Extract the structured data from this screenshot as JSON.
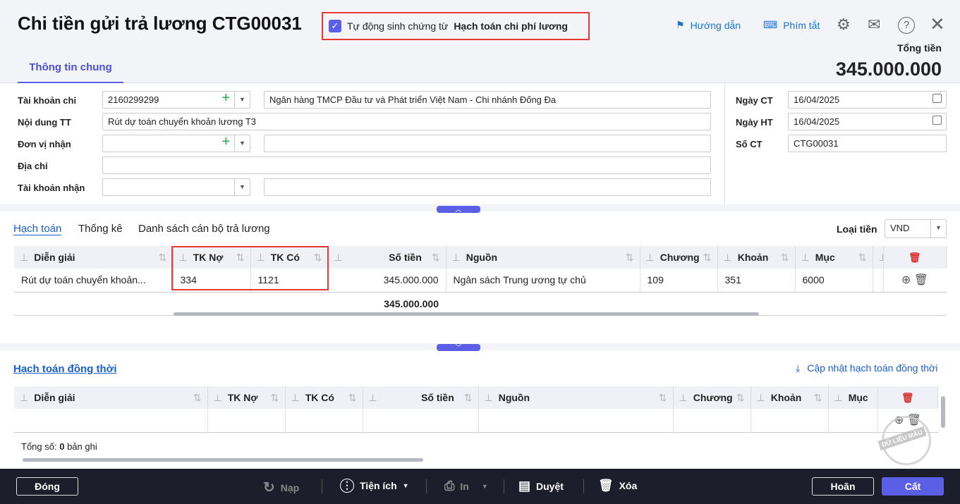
{
  "header": {
    "title": "Chi tiền gửi trả lương CTG00031",
    "auto_generate_label": "Tự động sinh chứng từ",
    "auto_generate_value": "Hạch toán chi phí lương",
    "auto_generate_checked": true,
    "guide": "Hướng dẫn",
    "shortcuts": "Phím tắt",
    "total_label": "Tổng tiền",
    "total_value": "345.000.000"
  },
  "tabs": [
    "Thông tin chung"
  ],
  "form": {
    "tk_chi_label": "Tài khoản chi",
    "tk_chi": "2160299299",
    "tk_chi_bank": "Ngân hàng TMCP Đầu tư và Phát triển Việt Nam - Chi nhánh Đống Đa",
    "noi_dung_label": "Nội dung TT",
    "noi_dung": "Rút dự toán chuyển khoản lương T3",
    "don_vi_label": "Đơn vị nhận",
    "don_vi": "",
    "don_vi_name": "",
    "dia_chi_label": "Địa chỉ",
    "dia_chi": "",
    "tk_nhan_label": "Tài khoản nhận",
    "tk_nhan": "",
    "tk_nhan_bank": "",
    "ngay_ct_label": "Ngày CT",
    "ngay_ct": "16/04/2025",
    "ngay_ht_label": "Ngày HT",
    "ngay_ht": "16/04/2025",
    "so_ct_label": "Số CT",
    "so_ct": "CTG00031"
  },
  "detail_tabs": [
    "Hạch toán",
    "Thống kê",
    "Danh sách cán bộ trả lương"
  ],
  "currency_label": "Loại tiền",
  "currency": "VND",
  "grid1": {
    "columns": [
      "Diễn giải",
      "TK Nợ",
      "TK Có",
      "Số tiền",
      "Nguồn",
      "Chương",
      "Khoản",
      "Mục"
    ],
    "rows": [
      [
        "Rút dự toán chuyển khoản...",
        "334",
        "1121",
        "345.000.000",
        "Ngân sách Trung ương tự chủ",
        "109",
        "351",
        "6000"
      ]
    ],
    "total": "345.000.000"
  },
  "grid2": {
    "title": "Hạch toán đồng thời",
    "update_label": "Cập nhật hạch toán đồng thời",
    "columns": [
      "Diễn giải",
      "TK Nợ",
      "TK Có",
      "Số tiền",
      "Nguồn",
      "Chương",
      "Khoản",
      "Mục"
    ],
    "count_prefix": "Tổng số:",
    "count": "0",
    "count_suffix": "bản ghi"
  },
  "watermark": "DỮ LIỆU MẪU",
  "footer": {
    "close": "Đóng",
    "reload": "Nạp",
    "utilities": "Tiện ích",
    "print": "In",
    "approve": "Duyệt",
    "delete": "Xóa",
    "cancel": "Hoãn",
    "save": "Cất"
  }
}
